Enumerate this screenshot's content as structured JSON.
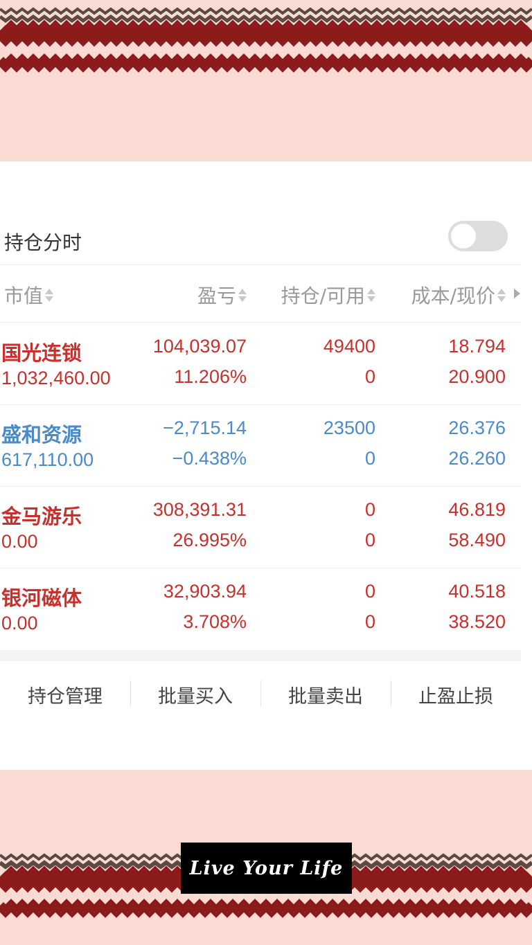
{
  "colors": {
    "background": "#fadbd3",
    "profit": "#c9302c",
    "loss": "#4a8ac9",
    "stripe_dark": "#8c1b1b",
    "stripe_brown": "#5a4a42"
  },
  "toggle": {
    "label": "持仓分时",
    "on": false
  },
  "headers": {
    "market_value": "市值",
    "profit_loss": "盈亏",
    "position_available": "持仓/可用",
    "cost_price": "成本/现价"
  },
  "holdings": [
    {
      "name": "国光连锁",
      "market_value": "1,032,460.00",
      "profit_loss": "104,039.07",
      "profit_loss_pct": "11.206%",
      "position": "49400",
      "available": "0",
      "cost": "18.794",
      "price": "20.900",
      "trend": "up"
    },
    {
      "name": "盛和资源",
      "market_value": "617,110.00",
      "profit_loss": "−2,715.14",
      "profit_loss_pct": "−0.438%",
      "position": "23500",
      "available": "0",
      "cost": "26.376",
      "price": "26.260",
      "trend": "down"
    },
    {
      "name": "金马游乐",
      "market_value": "0.00",
      "profit_loss": "308,391.31",
      "profit_loss_pct": "26.995%",
      "position": "0",
      "available": "0",
      "cost": "46.819",
      "price": "58.490",
      "trend": "up"
    },
    {
      "name": "银河磁体",
      "market_value": "0.00",
      "profit_loss": "32,903.94",
      "profit_loss_pct": "3.708%",
      "position": "0",
      "available": "0",
      "cost": "40.518",
      "price": "38.520",
      "trend": "up"
    }
  ],
  "actions": {
    "manage": "持仓管理",
    "batch_buy": "批量买入",
    "batch_sell": "批量卖出",
    "stop": "止盈止损"
  },
  "badge": {
    "text": "Live Your Life"
  }
}
